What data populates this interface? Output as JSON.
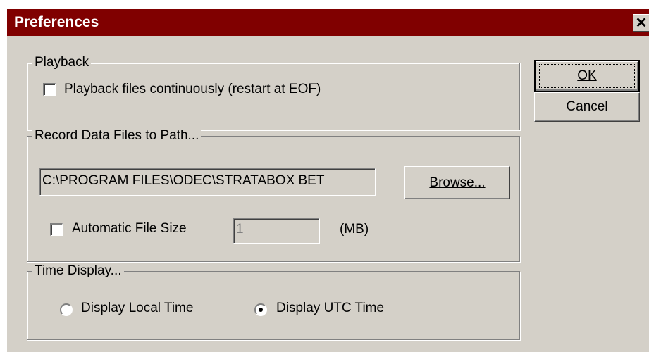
{
  "window": {
    "title": "Preferences",
    "close_glyph": "✕"
  },
  "buttons": {
    "ok_label": "OK",
    "cancel_label": "Cancel",
    "browse_label": "Browse..."
  },
  "playback": {
    "group_label": "Playback",
    "continuous_label": "Playback files continuously (restart at EOF)",
    "continuous_checked": false
  },
  "record": {
    "group_label": "Record Data Files to Path...",
    "path_value": "C:\\PROGRAM FILES\\ODEC\\STRATABOX BET",
    "auto_size_label": "Automatic File Size",
    "auto_size_checked": false,
    "file_size_value": "1",
    "unit_label": "(MB)"
  },
  "time_display": {
    "group_label": "Time Display...",
    "local_label": "Display Local Time",
    "utc_label": "Display UTC Time",
    "selected": "utc"
  }
}
